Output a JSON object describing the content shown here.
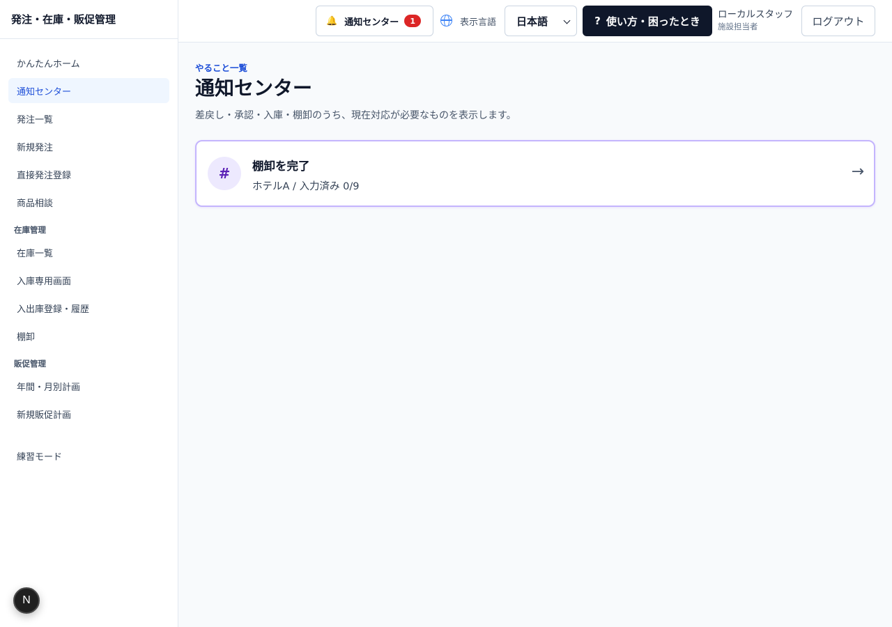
{
  "sidebar": {
    "brand": "発注・在庫・販促管理",
    "items": {
      "home": "かんたんホーム",
      "notifications": "通知センター",
      "orders": "発注一覧",
      "new_order": "新規発注",
      "direct_order": "直接発注登録",
      "product_consult": "商品相談",
      "inventory_section": "在庫管理",
      "inventory_list": "在庫一覧",
      "receiving": "入庫専用画面",
      "in_out": "入出庫登録・履歴",
      "stocktake": "棚卸",
      "promo_section": "販促管理",
      "plans": "年間・月別計画",
      "new_promo": "新規販促計画",
      "practice": "練習モード"
    },
    "active": "notifications",
    "floating_badge": "N"
  },
  "header": {
    "notification_label": "通知センター",
    "notification_count": "1",
    "language_label": "表示言語",
    "language_value": "日本語",
    "help_icon": "?",
    "help_label": "使い方・困ったとき",
    "user_name": "ローカルスタッフ",
    "user_role": "施設担当者",
    "logout_label": "ログアウト"
  },
  "main": {
    "eyebrow": "やること一覧",
    "title": "通知センター",
    "description": "差戻し・承認・入庫・棚卸のうち、現在対応が必要なものを表示します。",
    "task": {
      "icon": "#",
      "title": "棚卸を完了",
      "subtitle": "ホテルA / 入力済み 0/9",
      "arrow": "→"
    }
  },
  "colors": {
    "accent": "#1d4ed8",
    "dark_button": "#0f172a",
    "badge_red": "#dc2626",
    "card_border": "#c4b5fd"
  }
}
